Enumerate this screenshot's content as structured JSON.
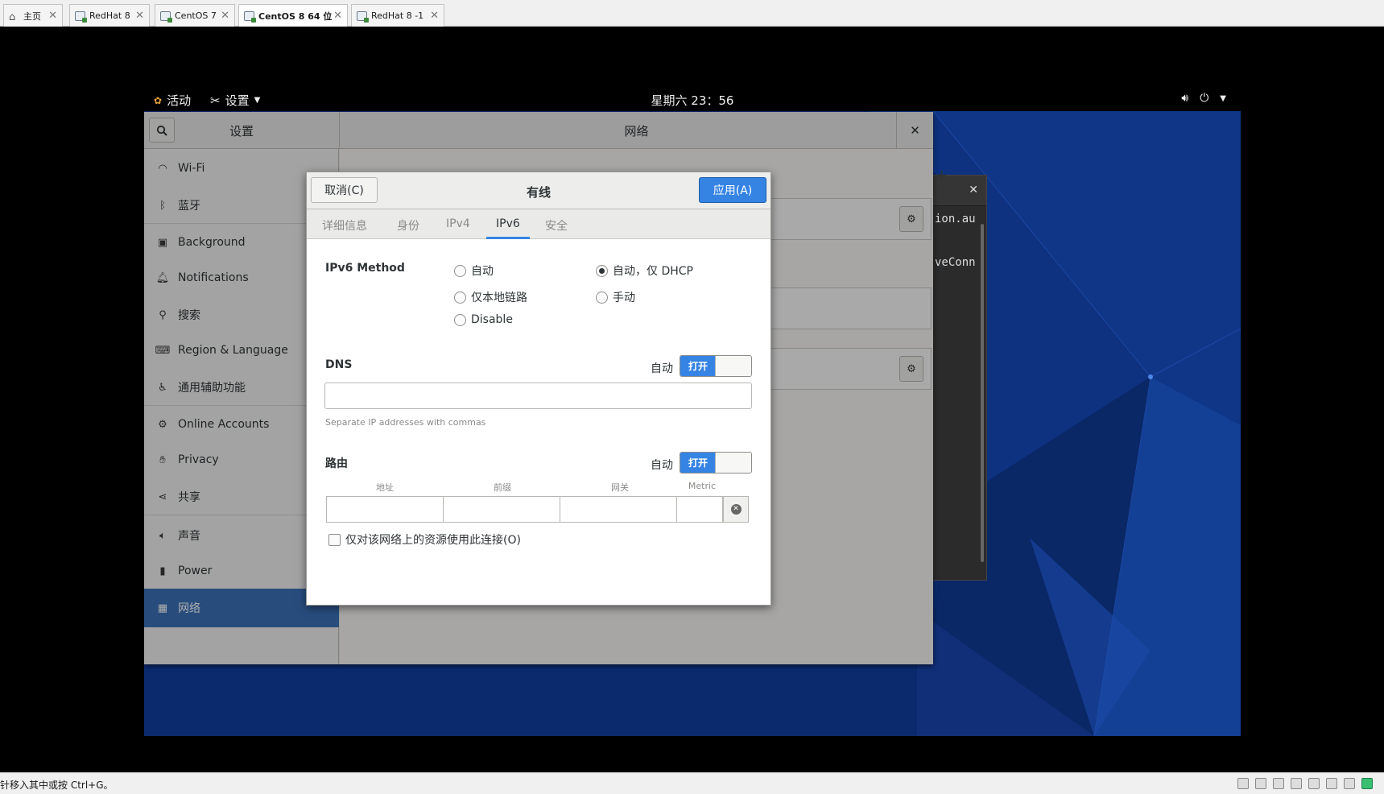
{
  "vmware": {
    "tabs": [
      {
        "label": "主页",
        "icon": "home-icon",
        "active": false
      },
      {
        "label": "RedHat 8",
        "icon": "vm-icon",
        "active": false
      },
      {
        "label": "CentOS 7",
        "icon": "vm-icon",
        "active": false
      },
      {
        "label": "CentOS 8 64 位",
        "icon": "vm-icon",
        "active": true
      },
      {
        "label": "RedHat 8 -1",
        "icon": "vm-icon",
        "active": false
      }
    ],
    "close_glyph": "✕",
    "status_message": "针移入其中或按 Ctrl+G。"
  },
  "topbar": {
    "activities": "活动",
    "app_menu": "设置",
    "clock": "星期六 23：56"
  },
  "terminal": {
    "lines": [
      "ion.au",
      "veConn"
    ],
    "close": "✕"
  },
  "settings": {
    "title": "设置",
    "panel_title": "网络",
    "close": "✕",
    "sidebar": [
      {
        "label": "Wi-Fi",
        "icon": "wifi-icon",
        "selected": false
      },
      {
        "label": "蓝牙",
        "icon": "bluetooth-icon",
        "selected": false
      },
      {
        "label": "Background",
        "icon": "background-icon",
        "selected": false
      },
      {
        "label": "Notifications",
        "icon": "bell-icon",
        "selected": false
      },
      {
        "label": "搜索",
        "icon": "search-icon",
        "selected": false
      },
      {
        "label": "Region & Language",
        "icon": "keyboard-icon",
        "selected": false
      },
      {
        "label": "通用辅助功能",
        "icon": "accessibility-icon",
        "selected": false
      },
      {
        "label": "Online Accounts",
        "icon": "online-accounts-icon",
        "selected": false
      },
      {
        "label": "Privacy",
        "icon": "hand-icon",
        "selected": false
      },
      {
        "label": "共享",
        "icon": "share-icon",
        "selected": false
      },
      {
        "label": "声音",
        "icon": "speaker-icon",
        "selected": false
      },
      {
        "label": "Power",
        "icon": "battery-icon",
        "selected": false
      },
      {
        "label": "网络",
        "icon": "network-icon",
        "selected": true
      }
    ]
  },
  "dialog": {
    "title": "有线",
    "cancel": "取消(C)",
    "apply": "应用(A)",
    "tabs": [
      "详细信息",
      "身份",
      "IPv4",
      "IPv6",
      "安全"
    ],
    "active_tab": "IPv6",
    "ipv6_method_label": "IPv6 Method",
    "methods": [
      {
        "label": "自动",
        "checked": false
      },
      {
        "label": "自动，仅 DHCP",
        "checked": true
      },
      {
        "label": "仅本地链路",
        "checked": false
      },
      {
        "label": "手动",
        "checked": false
      },
      {
        "label": "Disable",
        "checked": false
      }
    ],
    "dns": {
      "label": "DNS",
      "auto_label": "自动",
      "switch_on": "打开",
      "value": "",
      "hint": "Separate IP addresses with commas"
    },
    "routes": {
      "label": "路由",
      "auto_label": "自动",
      "switch_on": "打开",
      "columns": [
        "地址",
        "前缀",
        "网关",
        "Metric"
      ],
      "row": [
        "",
        "",
        "",
        ""
      ]
    },
    "only_resources": {
      "label": "仅对该网络上的资源使用此连接(O)",
      "checked": false
    }
  },
  "colors": {
    "accent": "#3584e4",
    "selected_sidebar": "#3c72b8",
    "wallpaper": "#0b2a6e"
  }
}
